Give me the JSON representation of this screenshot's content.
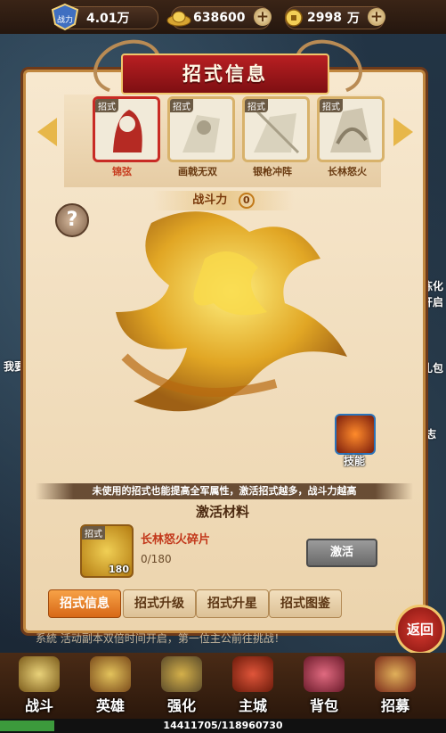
{
  "topbar": {
    "combat_badge": "战力",
    "combat_power": "4.01万",
    "gold": "638600",
    "coins": "2998",
    "coins_unit": "万",
    "plus": "+"
  },
  "panel": {
    "title": "招式信息",
    "cards": [
      {
        "tag": "招式",
        "name": "锦弦",
        "selected": true
      },
      {
        "tag": "招式",
        "name": "画戟无双",
        "selected": false
      },
      {
        "tag": "招式",
        "name": "银枪冲阵",
        "selected": false
      },
      {
        "tag": "招式",
        "name": "长林怒火",
        "selected": false
      }
    ],
    "power_label": "战斗力",
    "power_value": "0",
    "help_icon": "?",
    "skill_label": "技能",
    "info_text": "未使用的招式也能提高全军属性，激活招式越多，战斗力越高",
    "materials_title": "激活材料",
    "material": {
      "tag": "招式",
      "count": "180",
      "name": "长林怒火碎片",
      "progress": "0/180"
    },
    "activate_button": "激活",
    "tabs": [
      {
        "label": "招式信息",
        "selected": true
      },
      {
        "label": "招式升级",
        "selected": false
      },
      {
        "label": "招式升星",
        "selected": false
      },
      {
        "label": "招式图鉴",
        "selected": false
      }
    ],
    "back_button": "返回"
  },
  "background": {
    "marquee": "系統 活动副本双倍时间开启，第一位主公前往挑战！",
    "side_left": "我要",
    "side_right_1": "炼化",
    "side_right_2": "开启",
    "side_right_3": "礼包",
    "side_right_4": "志"
  },
  "bottom_nav": [
    {
      "label": "战斗",
      "icon": "crossed-swords-icon"
    },
    {
      "label": "英雄",
      "icon": "hero-helmet-icon"
    },
    {
      "label": "强化",
      "icon": "hammer-anvil-icon"
    },
    {
      "label": "主城",
      "icon": "castle-icon"
    },
    {
      "label": "背包",
      "icon": "backpack-icon"
    },
    {
      "label": "招募",
      "icon": "drum-icon"
    }
  ],
  "exp": {
    "text": "14411705/118960730",
    "fraction": 0.121
  },
  "colors": {
    "title_red": "#b81f22",
    "gold": "#e7b74a",
    "selected_tab": "#f7a247"
  }
}
